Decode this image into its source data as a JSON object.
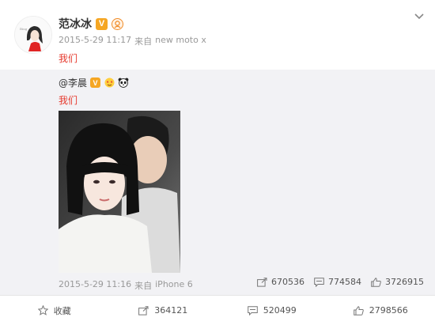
{
  "post": {
    "username": "范冰冰",
    "verified_badge": "V",
    "member_icon": "member-icon",
    "timestamp": "2015-5-29 11:17",
    "source_prefix": "来自",
    "source": "new moto x",
    "text": "我们"
  },
  "repost": {
    "mention": "@李晨",
    "verified_badge": "V",
    "text": "我们",
    "timestamp": "2015-5-29 11:16",
    "source_prefix": "来自",
    "source": "iPhone 6",
    "stats": {
      "reposts": "670536",
      "comments": "774584",
      "likes": "3726915"
    }
  },
  "actions": {
    "favorite_label": "收藏",
    "repost_count": "364121",
    "comment_count": "520499",
    "like_count": "2798566"
  },
  "colors": {
    "accent_red": "#e63a2e",
    "badge_orange": "#f5a623",
    "meta_gray": "#999999",
    "repost_bg": "#f2f2f5"
  }
}
